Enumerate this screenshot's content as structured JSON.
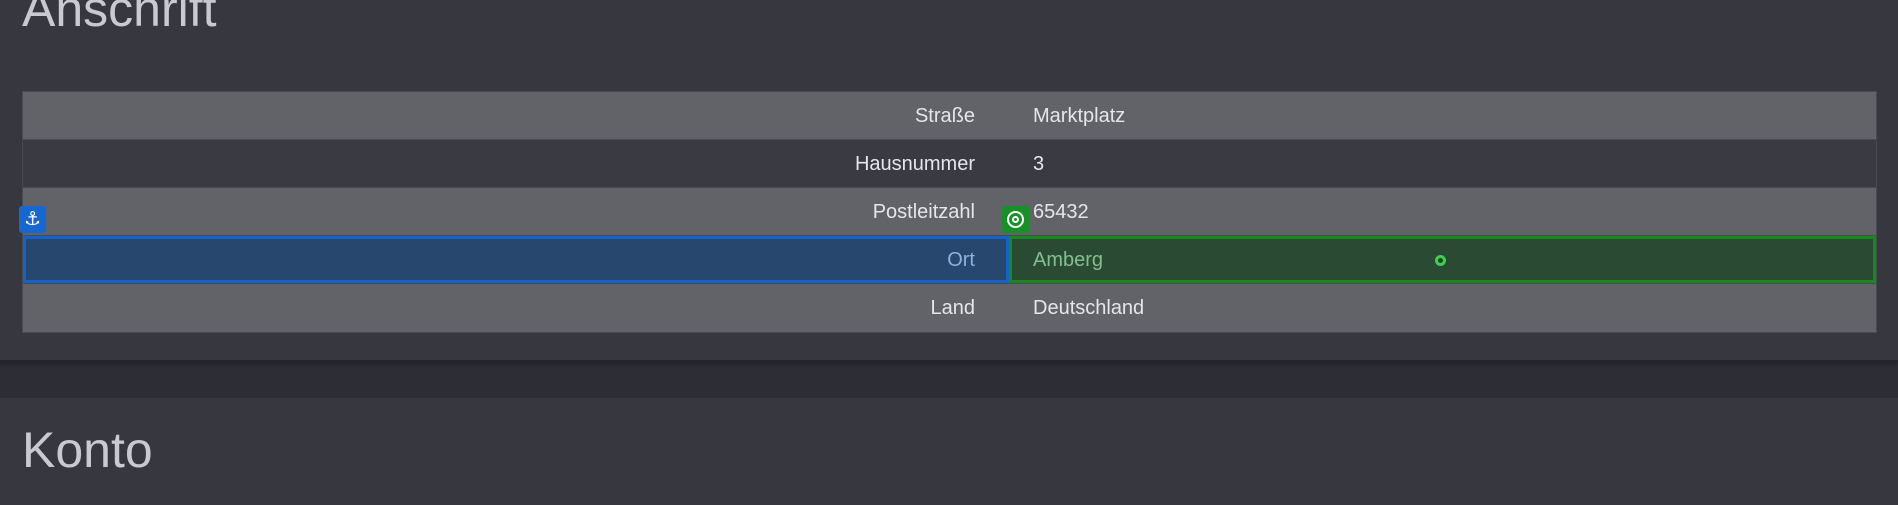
{
  "sections": {
    "address": {
      "title": "Anschrift",
      "rows": [
        {
          "label": "Straße",
          "value": "Marktplatz"
        },
        {
          "label": "Hausnummer",
          "value": "3"
        },
        {
          "label": "Postleitzahl",
          "value": "65432"
        },
        {
          "label": "Ort",
          "value": "Amberg"
        },
        {
          "label": "Land",
          "value": "Deutschland"
        }
      ]
    },
    "account": {
      "title": "Konto"
    }
  },
  "icons": {
    "anchor": "anchor-icon",
    "target": "target-icon",
    "cursor": "cursor-dot"
  },
  "colors": {
    "source_highlight": "#1463c8",
    "target_highlight": "#16891f"
  }
}
